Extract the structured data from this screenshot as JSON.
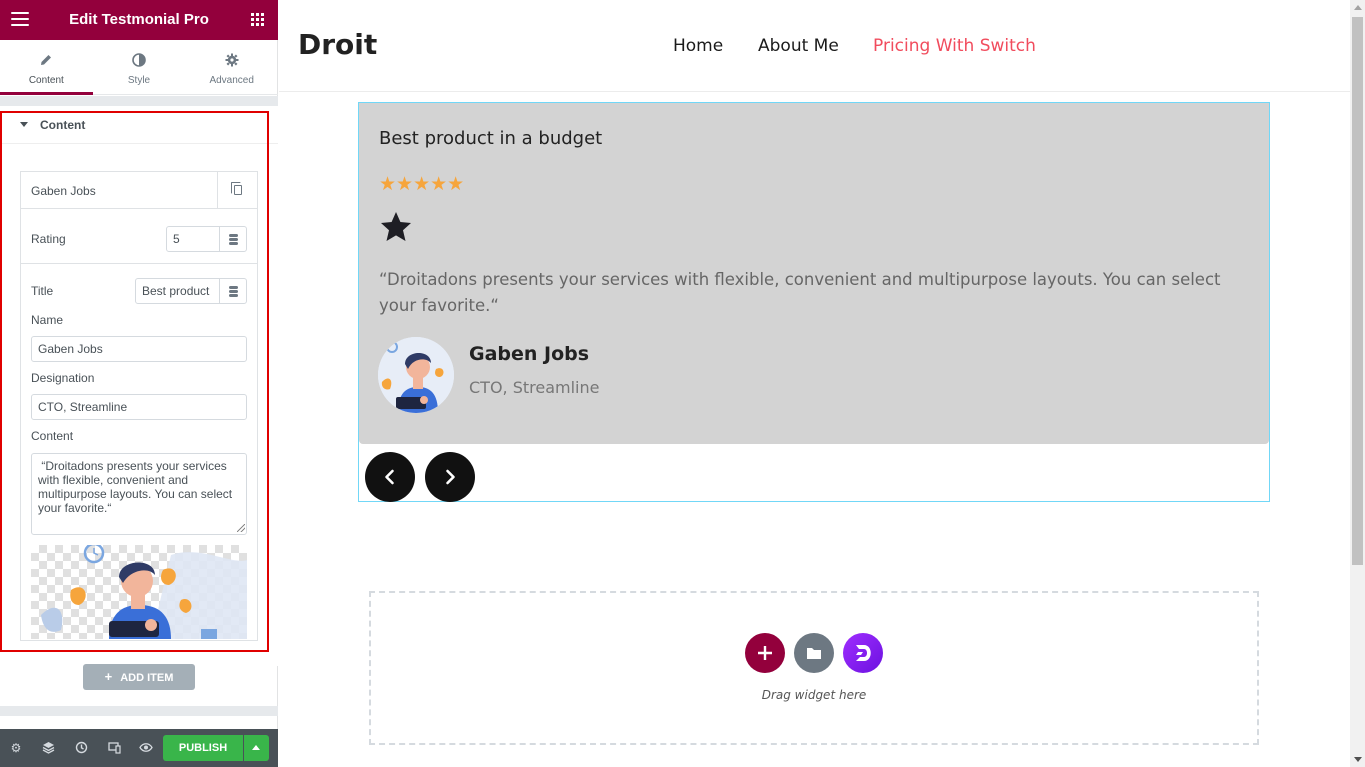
{
  "editor": {
    "title": "Edit Testmonial Pro",
    "tabs": [
      {
        "label": "Content",
        "icon": "pencil-icon"
      },
      {
        "label": "Style",
        "icon": "half-circle-icon"
      },
      {
        "label": "Advanced",
        "icon": "gear-icon"
      }
    ],
    "section_title": "Content",
    "item": {
      "title": "Gaben Jobs",
      "rating_label": "Rating",
      "rating_value": "5",
      "title_label": "Title",
      "title_value": "Best product in a budget",
      "name_label": "Name",
      "name_value": "Gaben Jobs",
      "designation_label": "Designation",
      "designation_value": "CTO, Streamline",
      "content_label": "Content",
      "content_value": " “Droitadons presents your services with flexible, convenient and multipurpose layouts. You can select your favorite.“"
    },
    "add_item_label": "ADD ITEM",
    "publish_label": "PUBLISH",
    "accent_color": "#93003c",
    "publish_color": "#39b54a"
  },
  "site": {
    "logo": "Droit",
    "nav": [
      {
        "label": "Home",
        "active": false
      },
      {
        "label": "About Me",
        "active": false
      },
      {
        "label": "Pricing With Switch",
        "active": true
      }
    ],
    "active_nav_color": "#f14c5d"
  },
  "testimonial": {
    "title": "Best product in a budget",
    "rating": 5,
    "stars": "★★★★★",
    "text": "“Droitadons presents your services with flexible, convenient and multipurpose layouts. You can select your favorite.“",
    "name": "Gaben Jobs",
    "designation": "CTO, Streamline",
    "card_color": "#d3d3d3",
    "star_color": "#f6a53c"
  },
  "dropzone": {
    "text": "Drag widget here"
  }
}
